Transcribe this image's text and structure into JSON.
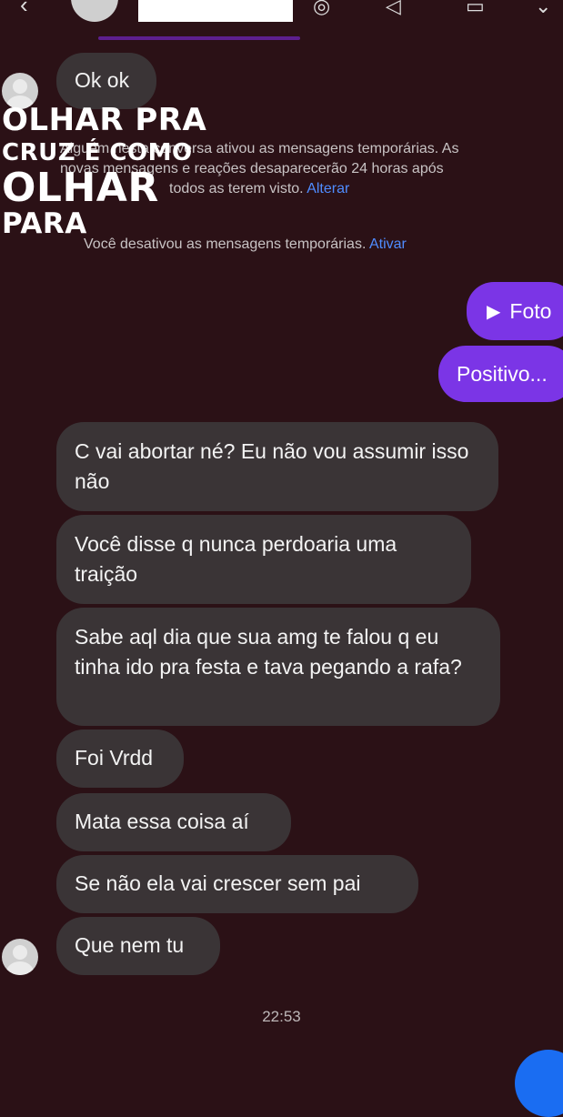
{
  "header": {
    "back_icon": "chevron-left-icon",
    "icons": [
      "audio-call-icon",
      "video-call-icon",
      "flag-icon"
    ]
  },
  "messages_received": [
    {
      "text": "Ok ok"
    },
    {
      "text": "C vai abortar né? Eu não vou assumir isso não"
    },
    {
      "text": "Você disse q nunca perdoaria uma traição"
    },
    {
      "text": "Sabe aql dia que sua amg te falou q eu tinha ido pra festa e tava pegando a rafa?"
    },
    {
      "text": "Foi Vrdd"
    },
    {
      "text": "Mata essa coisa aí"
    },
    {
      "text": "Se não ela vai crescer sem pai"
    },
    {
      "text": "Que nem tu"
    }
  ],
  "system": {
    "enabled_text_line1": "Alguém nesta conversa ativou as mensagens temporárias. As",
    "enabled_text_line2": "novas mensagens e reações desaparecerão 24 horas após",
    "enabled_text_line3": "todos as terem visto.",
    "enabled_link": "Alterar",
    "disabled_text": "Você desativou as mensagens temporárias.",
    "disabled_link": "Ativar"
  },
  "sent": {
    "photo_label": "Foto",
    "photo_icon": "play-triangle-icon",
    "message": "Positivo..."
  },
  "overlay": {
    "line1": "OLHAR PRA",
    "line2": "CRUZ É COMO",
    "line3": "OLHAR",
    "line4": "PARA"
  },
  "timestamp": "22:53",
  "colors": {
    "background": "#2b1116",
    "received_bubble": "#3a3436",
    "sent_bubble": "#7b35e6",
    "link": "#4f8cff",
    "fab": "#1a6df2"
  }
}
